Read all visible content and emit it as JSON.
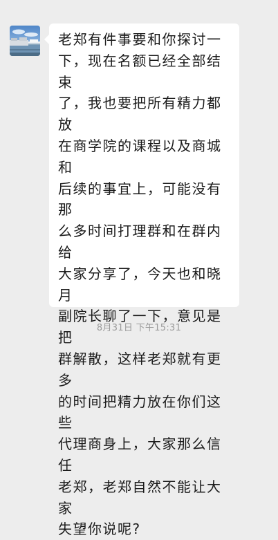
{
  "message": {
    "sender_avatar": "harbor-photo-avatar",
    "text": "老郑有件事要和你探讨一\n下，现在名额已经全部结束\n了，我也要把所有精力都放\n在商学院的课程以及商城和\n后续的事宜上，可能没有那\n么多时间打理群和在群内给\n大家分享了，今天也和晓月\n副院长聊了一下，意见是把\n群解散，这样老郑就有更多\n的时间把精力放在你们这些\n代理商身上，大家那么信任\n老郑，老郑自然不能让大家\n失望你说呢?"
  },
  "timestamp": "8月31日 下午15:31",
  "colors": {
    "background": "#ededed",
    "bubble": "#ffffff",
    "text": "#1b1b1b",
    "timestamp": "#9a9a9a"
  }
}
